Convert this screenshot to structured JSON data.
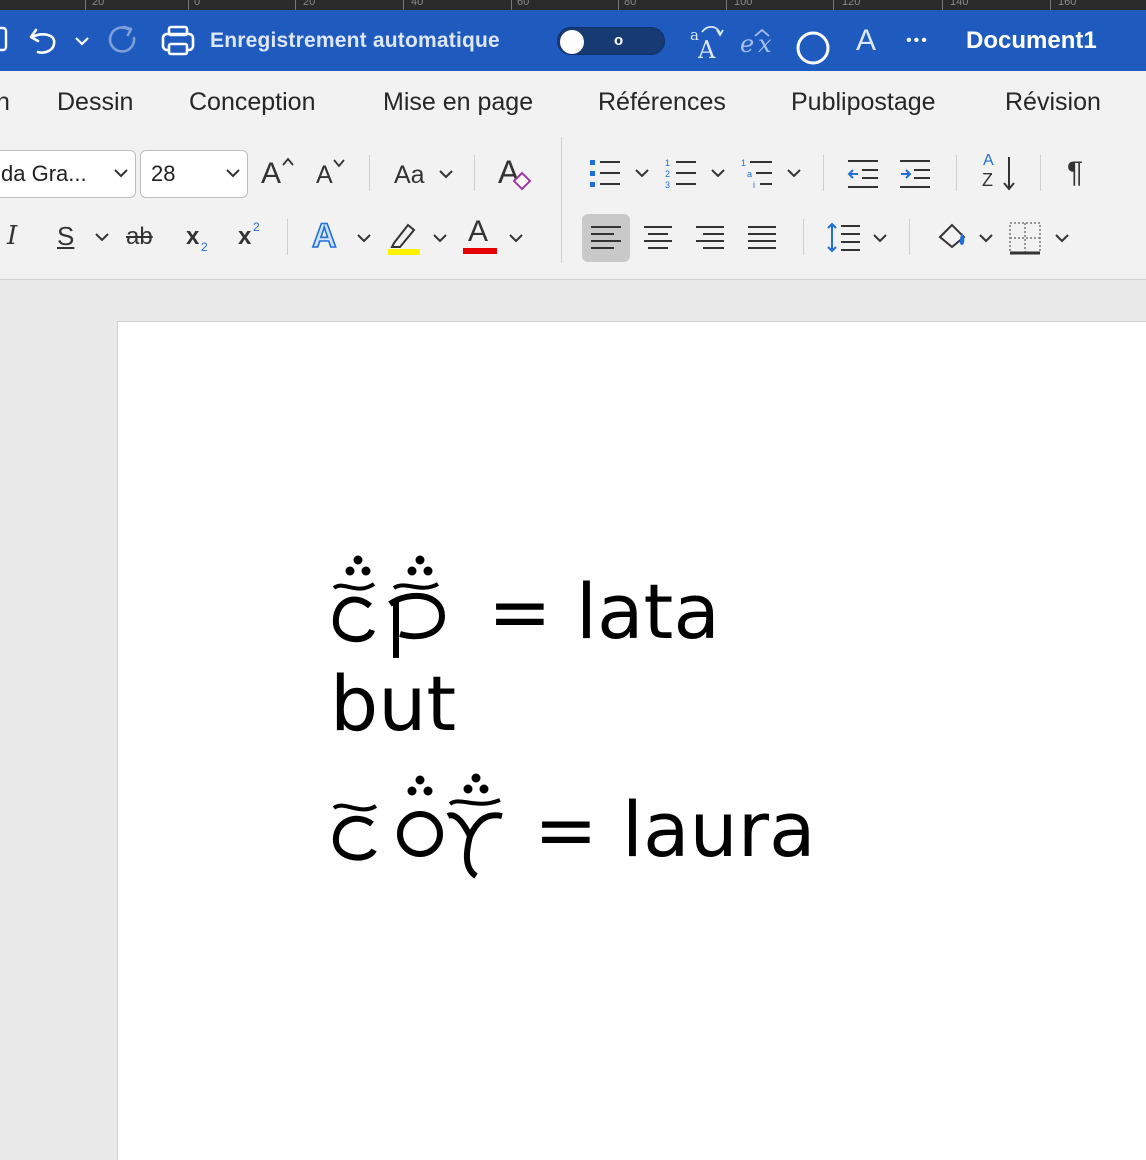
{
  "ruler": {
    "numbers": [
      "20",
      "0",
      "20",
      "40",
      "60",
      "80",
      "100",
      "120",
      "140",
      "160"
    ]
  },
  "titlebar": {
    "autosave_label": "Enregistrement automatique",
    "toggle_state": "o",
    "document_title": "Document1",
    "font_color_letter": "A",
    "more": "•••",
    "equation": "e x"
  },
  "tabs": [
    "n",
    "Dessin",
    "Conception",
    "Mise en page",
    "Références",
    "Publipostage",
    "Révision"
  ],
  "ribbon": {
    "font_name": "da Gra...",
    "font_size": "28",
    "change_case": "Aa",
    "paragraph_mark": "¶",
    "italic": "I",
    "underline": "S",
    "strike": "ab",
    "subscript": "x",
    "superscript": "x",
    "sub_num": "2",
    "sup_num": "2",
    "text_effects": "A",
    "font_color": "A",
    "grow": "A",
    "shrink": "A",
    "sort_a": "A",
    "sort_z": "Z",
    "highlight_color": "#fff200",
    "font_red": "#e60000"
  },
  "document": {
    "lines": [
      {
        "tengwar": "ƮԐ̈̃",
        "text": "= lata"
      },
      {
        "tengwar": "",
        "text": "but"
      },
      {
        "tengwar": "",
        "text": "= laura"
      }
    ]
  }
}
